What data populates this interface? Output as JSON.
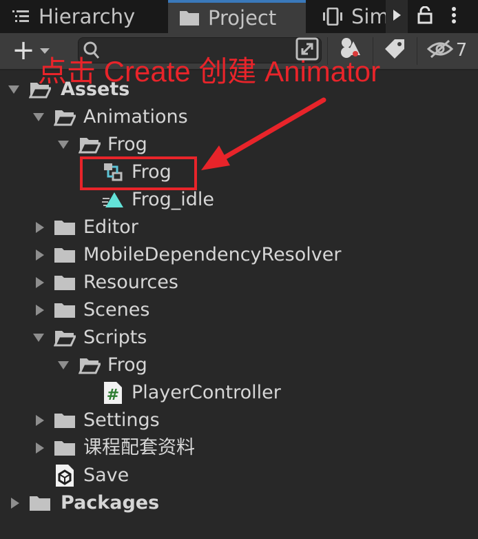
{
  "tabs": {
    "hierarchy": "Hierarchy",
    "project": "Project",
    "simulator": "Simulator"
  },
  "toolbar": {
    "add_label": "+",
    "hidden_count": "7"
  },
  "annotation": {
    "text": "点击 Create 创建 Animator",
    "color": "#e8242a"
  },
  "tree": [
    {
      "label": "Assets",
      "icon": "folder-open-icon",
      "expanded": true,
      "bold": true
    },
    {
      "label": "Animations",
      "icon": "folder-open-icon",
      "expanded": true
    },
    {
      "label": "Frog",
      "icon": "folder-open-icon",
      "expanded": true
    },
    {
      "label": "Frog",
      "icon": "animator-controller-icon"
    },
    {
      "label": "Frog_idle",
      "icon": "animation-clip-icon"
    },
    {
      "label": "Editor",
      "icon": "folder-icon",
      "expanded": false
    },
    {
      "label": "MobileDependencyResolver",
      "icon": "folder-icon",
      "expanded": false
    },
    {
      "label": "Resources",
      "icon": "folder-icon",
      "expanded": false
    },
    {
      "label": "Scenes",
      "icon": "folder-icon",
      "expanded": false
    },
    {
      "label": "Scripts",
      "icon": "folder-open-icon",
      "expanded": true
    },
    {
      "label": "Frog",
      "icon": "folder-open-icon",
      "expanded": true
    },
    {
      "label": "PlayerController",
      "icon": "csharp-script-icon"
    },
    {
      "label": "Settings",
      "icon": "folder-icon",
      "expanded": false
    },
    {
      "label": "课程配套资料",
      "icon": "folder-icon",
      "expanded": false
    },
    {
      "label": "Save",
      "icon": "unity-scene-icon"
    },
    {
      "label": "Packages",
      "icon": "folder-icon",
      "expanded": false,
      "bold": true
    }
  ]
}
